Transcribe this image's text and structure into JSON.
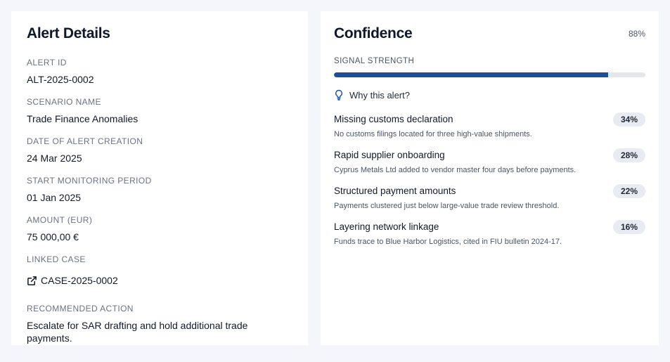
{
  "alert_details": {
    "title": "Alert Details",
    "fields": [
      {
        "label": "ALERT ID",
        "value": "ALT-2025-0002"
      },
      {
        "label": "SCENARIO NAME",
        "value": "Trade Finance Anomalies"
      },
      {
        "label": "DATE OF ALERT CREATION",
        "value": "24 Mar 2025"
      },
      {
        "label": "START MONITORING PERIOD",
        "value": "01 Jan 2025"
      },
      {
        "label": "AMOUNT (EUR)",
        "value": "75 000,00 €"
      }
    ],
    "linked_case": {
      "label": "LINKED CASE",
      "value": "CASE-2025-0002",
      "icon": "external-link-icon"
    },
    "recommended_action": {
      "label": "RECOMMENDED ACTION",
      "value": "Escalate for SAR drafting and hold additional trade payments."
    }
  },
  "confidence": {
    "title": "Confidence",
    "percent_label": "88%",
    "signal_label": "SIGNAL STRENGTH",
    "signal_value": 0.88,
    "signal_color": "#1d4e9e",
    "why_label": "Why this alert?",
    "why_icon": "lightbulb-icon",
    "reasons": [
      {
        "title": "Missing customs declaration",
        "badge": "34%",
        "description": "No customs filings located for three high-value shipments."
      },
      {
        "title": "Rapid supplier onboarding",
        "badge": "28%",
        "description": "Cyprus Metals Ltd added to vendor master four days before payments."
      },
      {
        "title": "Structured payment amounts",
        "badge": "22%",
        "description": "Payments clustered just below large-value trade review threshold."
      },
      {
        "title": "Layering network linkage",
        "badge": "16%",
        "description": "Funds trace to Blue Harbor Logistics, cited in FIU bulletin 2024-17."
      }
    ]
  }
}
